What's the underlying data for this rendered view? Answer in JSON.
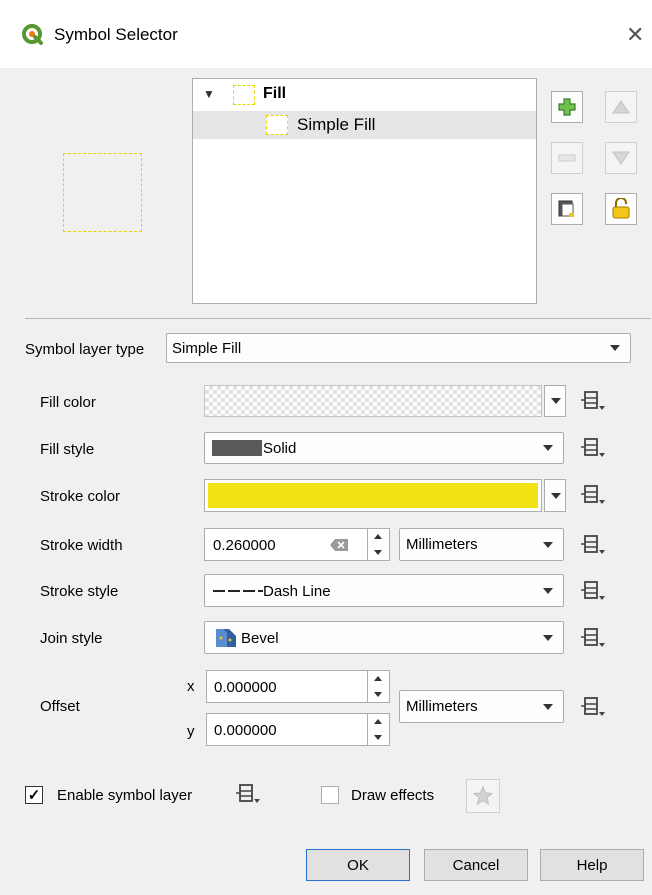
{
  "window": {
    "title": "Symbol Selector",
    "close_glyph": "✕"
  },
  "tree": {
    "expander_glyph": "▼",
    "items": [
      {
        "label": "Fill",
        "level": 0
      },
      {
        "label": "Simple Fill",
        "level": 1,
        "selected": true
      }
    ]
  },
  "colors": {
    "stroke_color": "#f0e215",
    "symbol_stroke": "#e6d400",
    "fill_swatch": "#5a5a5a",
    "qgis_green": "#589632"
  },
  "symbol_layer_type": {
    "label": "Symbol layer type",
    "value": "Simple Fill"
  },
  "properties": {
    "fill_color_label": "Fill color",
    "fill_style_label": "Fill style",
    "fill_style_value": "Solid",
    "stroke_color_label": "Stroke color",
    "stroke_width_label": "Stroke width",
    "stroke_width_value": "0.260000",
    "stroke_width_unit": "Millimeters",
    "stroke_style_label": "Stroke style",
    "stroke_style_value": "Dash Line",
    "join_style_label": "Join style",
    "join_style_value": "Bevel",
    "offset_label": "Offset",
    "offset_x_label": "x",
    "offset_x_value": "0.000000",
    "offset_y_label": "y",
    "offset_y_value": "0.000000",
    "offset_unit": "Millimeters"
  },
  "footer": {
    "enable_symbol_layer": "Enable symbol layer",
    "enable_checked": true,
    "checkmark": "✓",
    "draw_effects": "Draw effects",
    "draw_effects_checked": false
  },
  "buttons": {
    "ok": "OK",
    "cancel": "Cancel",
    "help": "Help"
  }
}
